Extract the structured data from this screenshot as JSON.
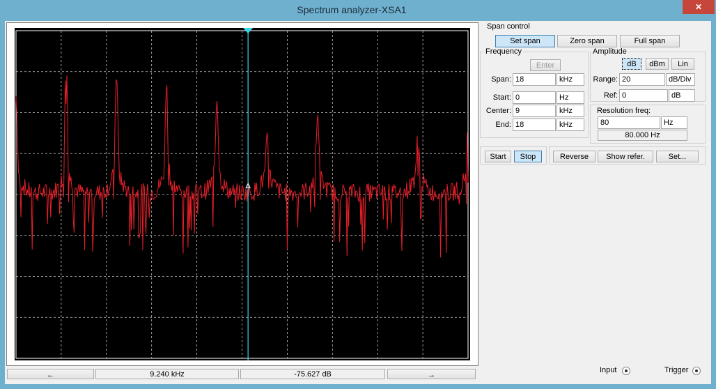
{
  "window": {
    "title": "Spectrum analyzer-XSA1",
    "close_glyph": "✕"
  },
  "span_control": {
    "title": "Span control",
    "buttons": [
      "Set span",
      "Zero span",
      "Full span"
    ],
    "active": "Set span"
  },
  "frequency": {
    "title": "Frequency",
    "enter_label": "Enter",
    "span": {
      "label": "Span:",
      "value": "18",
      "unit": "kHz"
    },
    "start": {
      "label": "Start:",
      "value": "0",
      "unit": "Hz"
    },
    "center": {
      "label": "Center:",
      "value": "9",
      "unit": "kHz"
    },
    "end": {
      "label": "End:",
      "value": "18",
      "unit": "kHz"
    }
  },
  "amplitude": {
    "title": "Amplitude",
    "modes": [
      "dB",
      "dBm",
      "Lin"
    ],
    "active_mode": "dB",
    "range": {
      "label": "Range:",
      "value": "20",
      "unit": "dB/Div"
    },
    "ref": {
      "label": "Ref:",
      "value": "0",
      "unit": "dB"
    }
  },
  "resolution": {
    "title": "Resolution freq:",
    "value": "80",
    "unit": "Hz",
    "readout": "80.000  Hz"
  },
  "controls": {
    "start_label": "Start",
    "stop_label": "Stop",
    "reverse_label": "Reverse",
    "show_refer_label": "Show refer.",
    "set_label": "Set..."
  },
  "readout": {
    "left_arrow": "←",
    "right_arrow": "→",
    "cursor_freq": "9.240 kHz",
    "cursor_level": "-75.627  dB"
  },
  "terminals": {
    "input_label": "Input",
    "trigger_label": "Trigger"
  },
  "colors": {
    "trace": "#e8202a",
    "cursor": "#39d7e8",
    "grid": "#c8c8c8",
    "screen_bg": "#000000",
    "title_bar": "#6fb0cf"
  },
  "chart_data": {
    "type": "line",
    "x_unit": "kHz",
    "xlim": [
      0,
      18
    ],
    "y_unit": "dB",
    "grid": true,
    "cursor": {
      "x": 9.24,
      "y": -75.627
    },
    "peaks": [
      {
        "x": 0.0,
        "y": -40
      },
      {
        "x": 2.0,
        "y": -19
      },
      {
        "x": 4.0,
        "y": -28
      },
      {
        "x": 6.0,
        "y": -30
      },
      {
        "x": 8.0,
        "y": -40
      },
      {
        "x": 10.0,
        "y": -62
      },
      {
        "x": 12.0,
        "y": -48
      },
      {
        "x": 16.0,
        "y": -58
      },
      {
        "x": 18.0,
        "y": -55
      }
    ]
  }
}
